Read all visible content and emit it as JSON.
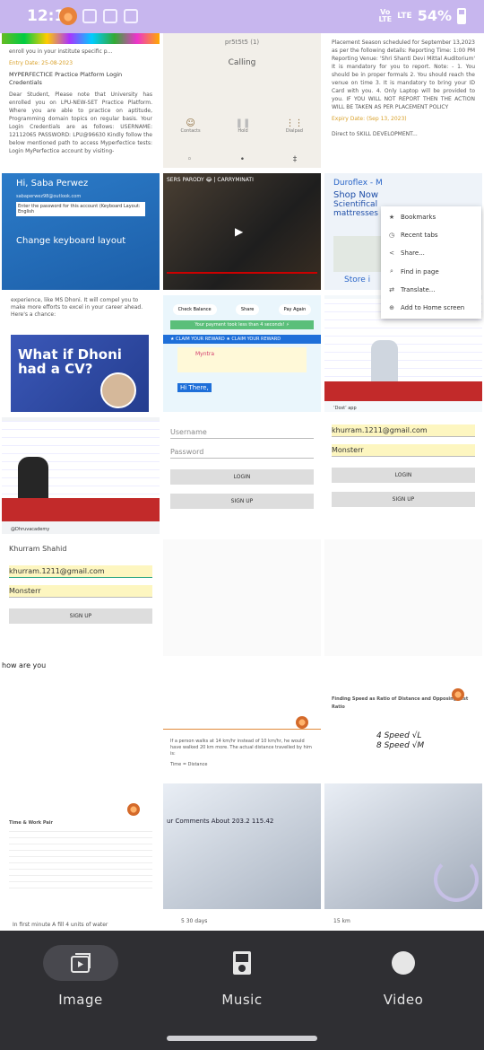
{
  "status": {
    "time": "12:12",
    "network_top": "Vo",
    "network_bottom": "LTE",
    "signal": "LTE",
    "battery": "54%"
  },
  "tiles": {
    "t1": {
      "lead": "enroll you in your institute specific p...",
      "date": "Entry Date: 25-08-2023",
      "heading": "MYPERFECTICE Practice Platform Login Credentials",
      "body": "Dear Student, Please note that University has enrolled you on LPU-NEW-SET Practice Platform. Where you are able to practice on aptitude, Programming domain topics on regular basis. Your Login Credentials are as follows: USERNAME: 12112065 PASSWORD: LPU@96630 Kindly follow the below mentioned path to access Myperfectice tests: Login MyPerfectice account by visiting-"
    },
    "t2": {
      "top": "pr5t5t5 (1)",
      "title": "Calling",
      "labels": [
        "Contacts",
        "Hold",
        "Dialpad"
      ]
    },
    "t3": {
      "body": "Placement Season scheduled for September 13,2023 as per the following details: Reporting Time: 1:00 PM Reporting Venue: 'Shri Shanti Devi Mittal Auditorium' It is mandatory for you to report. Note: - 1. You should be in proper formals 2. You should reach the venue on time 3. It is mandatory to bring your ID Card with you. 4. Only Laptop will be provided to you. IF YOU WILL NOT REPORT THEN THE ACTION WILL BE TAKEN AS PER PLACEMENT POLICY",
      "date": "Expiry Date: (Sep 13, 2023)",
      "tail": "Direct to SKILL DEVELOPMENT..."
    },
    "t4": {
      "hi": "Hi, Saba Perwez",
      "email": "sabaperwez98@outlook.com",
      "prompt": "Enter the password for this account (Keyboard Layout: English",
      "link": "Change keyboard layout"
    },
    "t5": {
      "title": "SERS PARODY 😂 | CARRYMINATI"
    },
    "t6": {
      "line1": "Duroflex - M",
      "line2": "Shop Now",
      "line3": "Scientifical",
      "line4": "mattresses",
      "store": "Store i"
    },
    "menu": {
      "items": [
        {
          "icon": "★",
          "label": "Bookmarks"
        },
        {
          "icon": "◷",
          "label": "Recent tabs"
        },
        {
          "icon": "<",
          "label": "Share..."
        },
        {
          "icon": "⌕",
          "label": "Find in page"
        },
        {
          "icon": "⇄",
          "label": "Translate..."
        },
        {
          "icon": "⊕",
          "label": "Add to Home screen"
        }
      ]
    },
    "t7": {
      "text": "experience, like MS Dhoni. It will compel you to make more efforts to excel in your career ahead. Here's a chance:",
      "headline": "What if Dhoni had a CV?"
    },
    "t8": {
      "btn1": "Check Balance",
      "btn2": "Share",
      "btn3": "Pay Again",
      "note": "Your payment took less than 4 seconds! ⚡",
      "claim": "★ CLAIM YOUR REWARD ★ CLAIM YOUR REWARD",
      "brand": "Myntra",
      "chat": "Hi There,"
    },
    "t9": {
      "caption": "‘Dost’ app"
    },
    "t10": {
      "caption": "@Dhruvacademy"
    },
    "t11": {
      "username": "Username",
      "password": "Password",
      "login": "LOGIN",
      "signup": "SIGN UP"
    },
    "t12": {
      "email": "khurram.1211@gmail.com",
      "password": "Monsterr",
      "login": "LOGIN",
      "signup": "SIGN UP"
    },
    "t13": {
      "name": "Khurram Shahid",
      "email": "khurram.1211@gmail.com",
      "password": "Monsterr",
      "signup": "SIGN UP"
    },
    "t14": {
      "text": "how are you"
    },
    "t15": {
      "line1": "If a person walks at 14 km/hr instead of 10 km/hr, he would have walked 20 km more. The actual distance travelled by him is:",
      "line2": "Time = Distance"
    },
    "t16": {
      "title": "Finding Speed as Ratio of Distance and Opposing Dist Ratio",
      "ratio_a": "4 Speed",
      "ratio_b": "8 Speed",
      "frac_a": "√L",
      "frac_b": "√M"
    },
    "t17": {
      "title": "Time & Work Pair",
      "bottom": "In first minute A fill 4 units of water"
    },
    "t18": {
      "title": "ur Comments About 203.2 115.42",
      "bottom": "5 30 days"
    },
    "t19": {
      "bottom": "15 km"
    }
  },
  "nav": {
    "items": [
      {
        "label": "Image",
        "active": true
      },
      {
        "label": "Music",
        "active": false
      },
      {
        "label": "Video",
        "active": false
      }
    ]
  },
  "colors": {
    "statusbar": "#c7b6ee",
    "nav": "#2f2f33",
    "accent_yellow": "#fdf6c0"
  }
}
